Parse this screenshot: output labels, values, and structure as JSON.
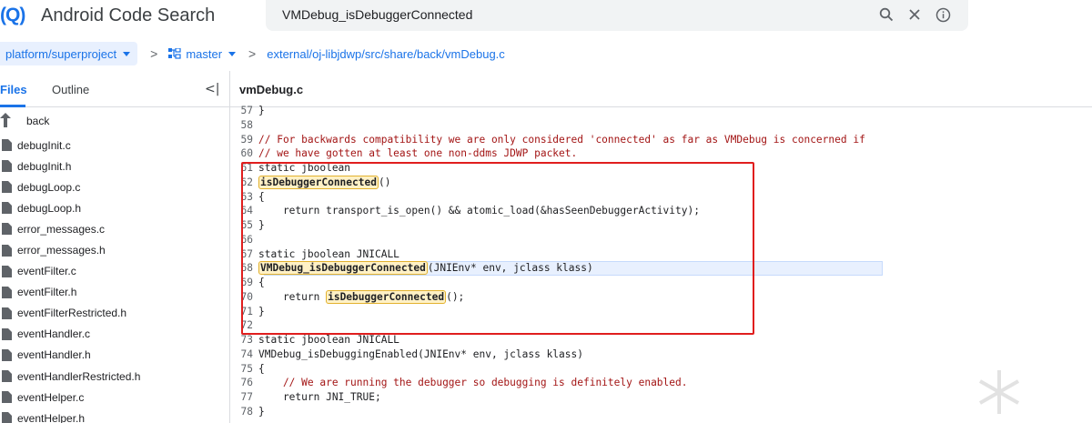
{
  "header": {
    "logo_mark": "(Q)",
    "app_title": "Android Code Search",
    "search_query": "VMDebug_isDebuggerConnected"
  },
  "breadcrumb": {
    "repo": "platform/superproject",
    "sep1": ">",
    "branch": "master",
    "sep2": ">",
    "path": "external/oj-libjdwp/src/share/back/vmDebug.c"
  },
  "left_panel": {
    "tab_files": "Files",
    "tab_outline": "Outline",
    "collapse_glyph": "<|",
    "back_label": "back",
    "files": [
      "debugInit.c",
      "debugInit.h",
      "debugLoop.c",
      "debugLoop.h",
      "error_messages.c",
      "error_messages.h",
      "eventFilter.c",
      "eventFilter.h",
      "eventFilterRestricted.h",
      "eventHandler.c",
      "eventHandler.h",
      "eventHandlerRestricted.h",
      "eventHelper.c",
      "eventHelper.h"
    ]
  },
  "code": {
    "file_title": "vmDebug.c",
    "lines": [
      {
        "n": "57",
        "t": "}"
      },
      {
        "n": "58",
        "t": ""
      },
      {
        "n": "59",
        "t": "// For backwards compatibility we are only considered 'connected' as far as VMDebug is concerned if"
      },
      {
        "n": "60",
        "t": "// we have gotten at least one non-ddms JDWP packet."
      },
      {
        "n": "61",
        "t": "static jboolean"
      },
      {
        "n": "62",
        "t": "isDebuggerConnected",
        "tail": "()"
      },
      {
        "n": "63",
        "t": "{"
      },
      {
        "n": "64",
        "t": "    return transport_is_open() && atomic_load(&hasSeenDebuggerActivity);"
      },
      {
        "n": "65",
        "t": "}"
      },
      {
        "n": "66",
        "t": ""
      },
      {
        "n": "67",
        "t": "static jboolean JNICALL"
      },
      {
        "n": "68",
        "t": "VMDebug_isDebuggerConnected",
        "tail": "(JNIEnv* env, jclass klass)"
      },
      {
        "n": "69",
        "t": "{"
      },
      {
        "n": "70",
        "head": "    return ",
        "t": "isDebuggerConnected",
        "tail": "();"
      },
      {
        "n": "71",
        "t": "}"
      },
      {
        "n": "72",
        "t": ""
      },
      {
        "n": "73",
        "t": "static jboolean JNICALL"
      },
      {
        "n": "74",
        "t": "VMDebug_isDebuggingEnabled(JNIEnv* env, jclass klass)"
      },
      {
        "n": "75",
        "t": "{"
      },
      {
        "n": "76",
        "t": "    // We are running the debugger so debugging is definitely enabled."
      },
      {
        "n": "77",
        "t": "    return JNI_TRUE;"
      },
      {
        "n": "78",
        "t": "}"
      }
    ]
  },
  "colors": {
    "accent": "#1a73e8",
    "highlight_row": "#e8f0fe",
    "match_highlight": "#fff1c6",
    "annotation_box": "#e01e1e",
    "comment": "#a31515"
  },
  "icons": [
    "search-icon",
    "clear-icon",
    "info-icon",
    "branch-icon",
    "back-arrow-icon",
    "file-icon",
    "collapse-panel-icon"
  ]
}
